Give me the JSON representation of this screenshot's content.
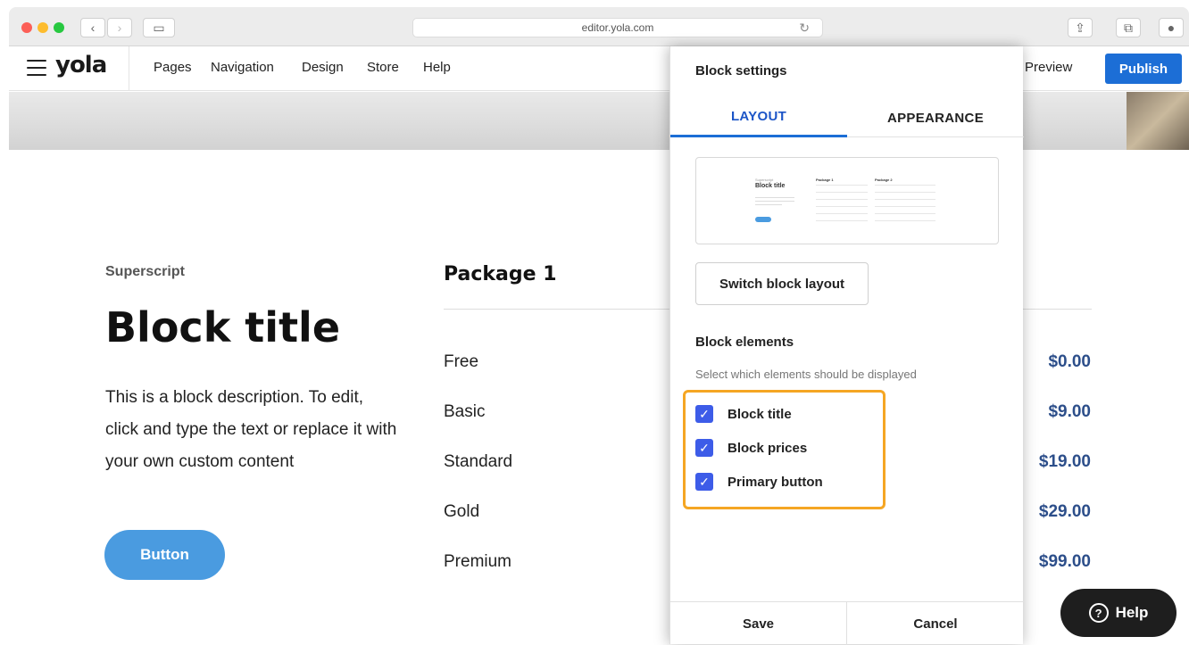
{
  "browser": {
    "url": "editor.yola.com"
  },
  "topbar": {
    "logo": "yola",
    "menu": [
      "Pages",
      "Navigation",
      "Design",
      "Store",
      "Help"
    ],
    "preview_label": "Preview",
    "publish_label": "Publish"
  },
  "page": {
    "superscript": "Superscript",
    "block_title": "Block title",
    "description": "This is a block description. To edit, click and type the text or replace it with your own custom content",
    "button_label": "Button",
    "package_title": "Package 1",
    "tiers": [
      {
        "name": "Free",
        "price": "$0.00"
      },
      {
        "name": "Basic",
        "price": "$9.00"
      },
      {
        "name": "Standard",
        "price": "$19.00"
      },
      {
        "name": "Gold",
        "price": "$29.00"
      },
      {
        "name": "Premium",
        "price": "$99.00"
      }
    ]
  },
  "panel": {
    "title": "Block settings",
    "tabs": [
      "LAYOUT",
      "APPEARANCE"
    ],
    "active_tab": "LAYOUT",
    "switch_layout_label": "Switch block layout",
    "elements_title": "Block elements",
    "elements_subtitle": "Select which elements should be displayed",
    "elements": [
      {
        "label": "Block title",
        "checked": true
      },
      {
        "label": "Block prices",
        "checked": true
      },
      {
        "label": "Primary button",
        "checked": true
      }
    ],
    "save_label": "Save",
    "cancel_label": "Cancel"
  },
  "help_label": "Help",
  "colors": {
    "publish": "#1c6ed6",
    "button": "#4a9be0",
    "price": "#2c4e8a",
    "checkbox": "#3d5ce8",
    "highlight": "#f5a623"
  }
}
